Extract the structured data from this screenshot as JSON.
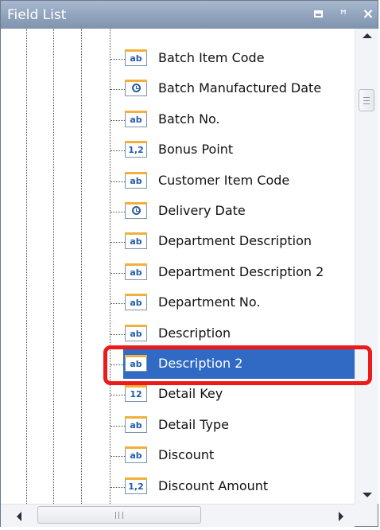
{
  "panel": {
    "title": "Field List"
  },
  "fields": [
    {
      "label": "Batch Item Code",
      "icon": "string-icon",
      "glyph": "ab"
    },
    {
      "label": "Batch Manufactured Date",
      "icon": "date-icon",
      "glyph": ""
    },
    {
      "label": "Batch No.",
      "icon": "string-icon",
      "glyph": "ab"
    },
    {
      "label": "Bonus Point",
      "icon": "decimal-icon",
      "glyph": "1,2"
    },
    {
      "label": "Customer Item Code",
      "icon": "string-icon",
      "glyph": "ab"
    },
    {
      "label": "Delivery Date",
      "icon": "date-icon",
      "glyph": ""
    },
    {
      "label": "Department Description",
      "icon": "string-icon",
      "glyph": "ab"
    },
    {
      "label": "Department Description 2",
      "icon": "string-icon",
      "glyph": "ab"
    },
    {
      "label": "Department No.",
      "icon": "string-icon",
      "glyph": "ab"
    },
    {
      "label": "Description",
      "icon": "string-icon",
      "glyph": "ab"
    },
    {
      "label": "Description 2",
      "icon": "string-icon",
      "glyph": "ab",
      "selected": true
    },
    {
      "label": "Detail Key",
      "icon": "integer-icon",
      "glyph": "12"
    },
    {
      "label": "Detail Type",
      "icon": "string-icon",
      "glyph": "ab"
    },
    {
      "label": "Discount",
      "icon": "string-icon",
      "glyph": "ab"
    },
    {
      "label": "Discount Amount",
      "icon": "decimal-icon",
      "glyph": "1,2"
    }
  ],
  "colors": {
    "titlebar": "#8fa3bd",
    "selection": "#316ac5",
    "highlight_border": "#ea1b1b",
    "icon_accent": "#f0b03b"
  }
}
